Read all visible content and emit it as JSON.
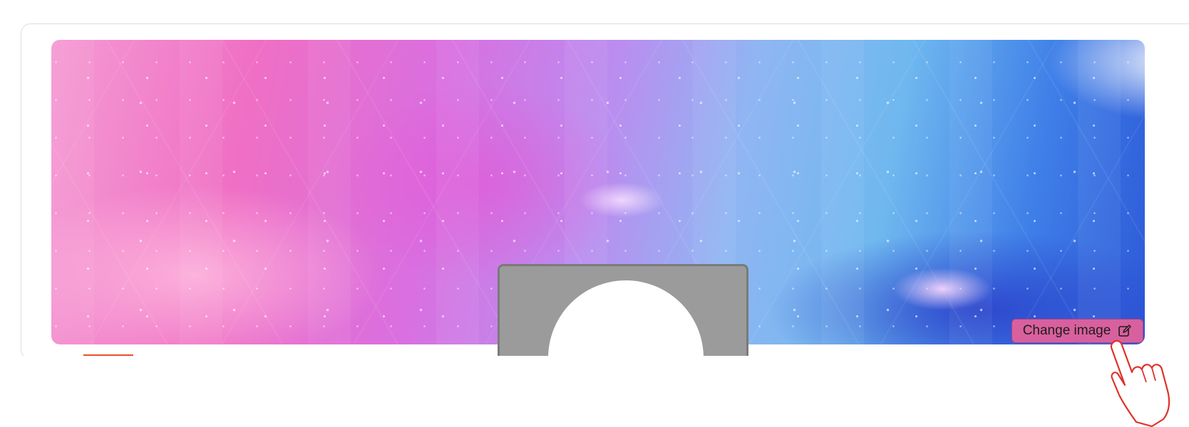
{
  "cover": {
    "button_label": "Change image",
    "button_icon": "edit-icon",
    "accent_color": "#d9609e"
  },
  "avatar": {
    "frame_color": "#9b9b9b"
  },
  "cursor": {
    "icon": "pointing-hand-cursor-icon"
  }
}
